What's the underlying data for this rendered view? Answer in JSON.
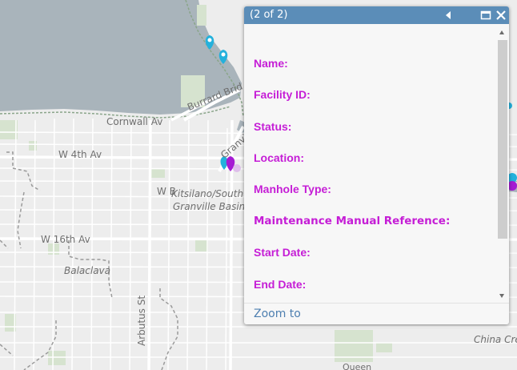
{
  "map": {
    "labels": {
      "cornwall": "Cornwall Av",
      "w4": "W 4th Av",
      "w16": "W 16th Av",
      "balaclava": "Balaclava",
      "arbutus": "Arbutus St",
      "burrard": "Burrard Brid",
      "kits": "Kitsilano/South",
      "basin": "Granville Basin",
      "wb": "W B",
      "granville": "Granville B",
      "china": "China Cre",
      "queen": "Queen"
    },
    "colors": {
      "water": "#a9b4bb",
      "land": "#ededed",
      "park": "#d6e3cf",
      "marker_cyan": "#24b1dc",
      "marker_purple": "#a51bd3"
    }
  },
  "popup": {
    "title": "(2 of 2)",
    "icons": {
      "prev": "triangle-left-icon",
      "maximize": "maximize-icon",
      "close": "close-icon"
    },
    "fields": [
      "Name:",
      "Facility ID:",
      "Status:",
      "Location:",
      "Manhole Type:",
      "Maintenance Manual Reference:",
      "Start Date:",
      "End Date:"
    ],
    "zoom_label": "Zoom to",
    "colors": {
      "header": "#5b8db8",
      "field_label": "#c51ed6",
      "link": "#4e7fb0"
    }
  }
}
